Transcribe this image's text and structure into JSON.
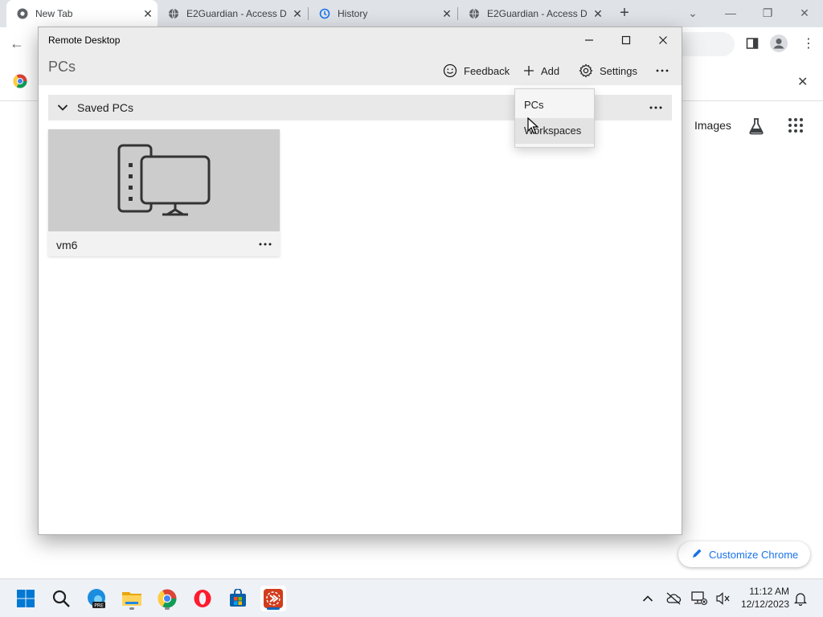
{
  "browser": {
    "tabs": [
      {
        "title": "New Tab",
        "icon": "chrome-icon",
        "active": true
      },
      {
        "title": "E2Guardian - Access D",
        "icon": "globe-icon",
        "active": false
      },
      {
        "title": "History",
        "icon": "history-icon",
        "active": false
      },
      {
        "title": "E2Guardian - Access D",
        "icon": "globe-icon",
        "active": false
      }
    ],
    "new_tab_label": "+",
    "images_link": "Images",
    "customize_label": "Customize Chrome"
  },
  "remote_desktop": {
    "window_title": "Remote Desktop",
    "page_title": "PCs",
    "commands": {
      "feedback": "Feedback",
      "add": "Add",
      "settings": "Settings"
    },
    "group": {
      "label": "Saved PCs",
      "expanded": true
    },
    "pcs": [
      {
        "name": "vm6"
      }
    ],
    "add_menu": {
      "items": [
        "PCs",
        "Workspaces"
      ],
      "hovered_index": 1
    }
  },
  "taskbar": {
    "apps": [
      "windows-start-icon",
      "search-icon",
      "edge-beta-icon",
      "file-explorer-icon",
      "chrome-icon",
      "opera-icon",
      "microsoft-store-icon",
      "remote-desktop-icon"
    ],
    "active_app": "remote-desktop-icon",
    "clock": {
      "time": "11:12 AM",
      "date": "12/12/2023"
    }
  },
  "colors": {
    "accent": "#0067c0",
    "link_blue": "#1a73e8",
    "opera_red": "#ff1b2d"
  }
}
